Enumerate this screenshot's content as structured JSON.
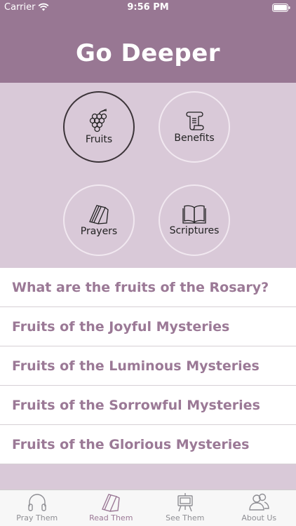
{
  "status": {
    "carrier": "Carrier",
    "time": "9:56 PM"
  },
  "header": {
    "title": "Go Deeper"
  },
  "categories": [
    {
      "label": "Fruits",
      "icon": "grapes-icon",
      "selected": true
    },
    {
      "label": "Benefits",
      "icon": "scroll-icon",
      "selected": false
    },
    {
      "label": "Prayers",
      "icon": "booklet-icon",
      "selected": false
    },
    {
      "label": "Scriptures",
      "icon": "open-book-icon",
      "selected": false
    }
  ],
  "list": [
    "What are the fruits of the Rosary?",
    "Fruits of the Joyful Mysteries",
    "Fruits of the Luminous Mysteries",
    "Fruits of the Sorrowful Mysteries",
    "Fruits of the Glorious Mysteries"
  ],
  "tabs": [
    {
      "label": "Pray Them",
      "icon": "headphones-icon",
      "selected": false
    },
    {
      "label": "Read Them",
      "icon": "book-icon",
      "selected": true
    },
    {
      "label": "See Them",
      "icon": "easel-icon",
      "selected": false
    },
    {
      "label": "About Us",
      "icon": "users-icon",
      "selected": false
    }
  ],
  "colors": {
    "header": "#987793",
    "accent": "#9b7996",
    "panel": "#d9c9d8",
    "tab_inactive": "#8e8e93"
  }
}
